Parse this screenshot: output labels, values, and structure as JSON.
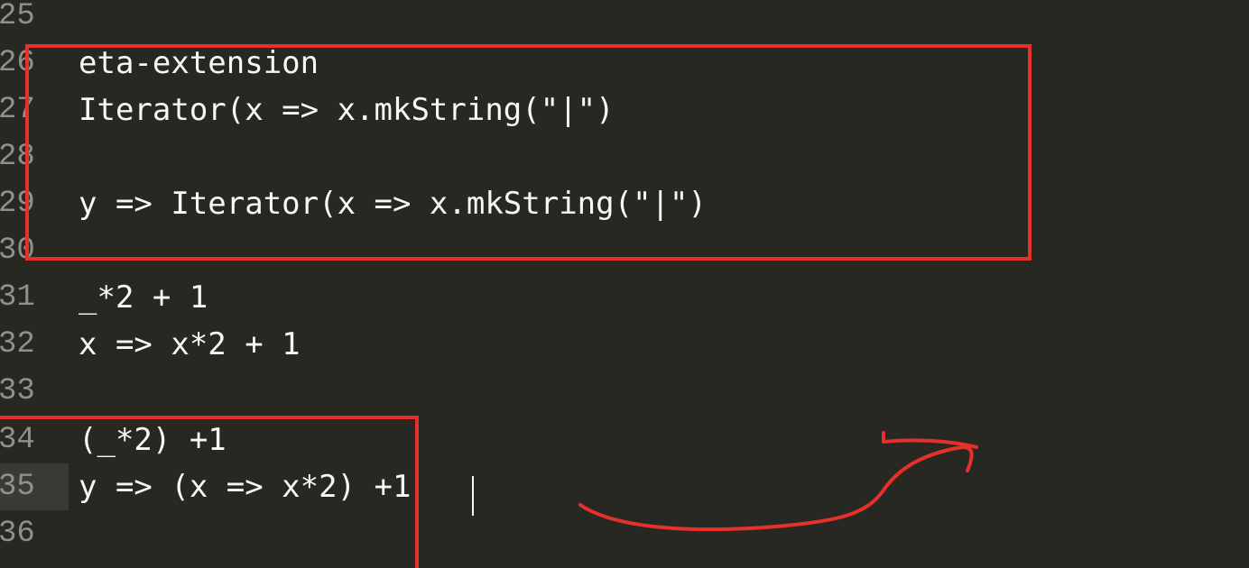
{
  "editor": {
    "lines": [
      {
        "number": "25",
        "text": ""
      },
      {
        "number": "26",
        "text": "eta-extension"
      },
      {
        "number": "27",
        "text": "Iterator(x => x.mkString(\"|\")"
      },
      {
        "number": "28",
        "text": ""
      },
      {
        "number": "29",
        "text": "y => Iterator(x => x.mkString(\"|\")"
      },
      {
        "number": "30",
        "text": ""
      },
      {
        "number": "31",
        "text": "_*2 + 1"
      },
      {
        "number": "32",
        "text": "x => x*2 + 1"
      },
      {
        "number": "33",
        "text": ""
      },
      {
        "number": "34",
        "text": "(_*2) +1"
      },
      {
        "number": "35",
        "text": "y => (x => x*2) +1"
      },
      {
        "number": "36",
        "text": ""
      }
    ],
    "active_line": "35"
  },
  "annotations": {
    "color": "#e8302a",
    "shapes": [
      "rectangle",
      "rectangle",
      "arrow"
    ]
  },
  "colors": {
    "background": "#272822",
    "text": "#f8f8f2",
    "gutter_text": "#90918b",
    "active_gutter": "#3a3b35"
  }
}
